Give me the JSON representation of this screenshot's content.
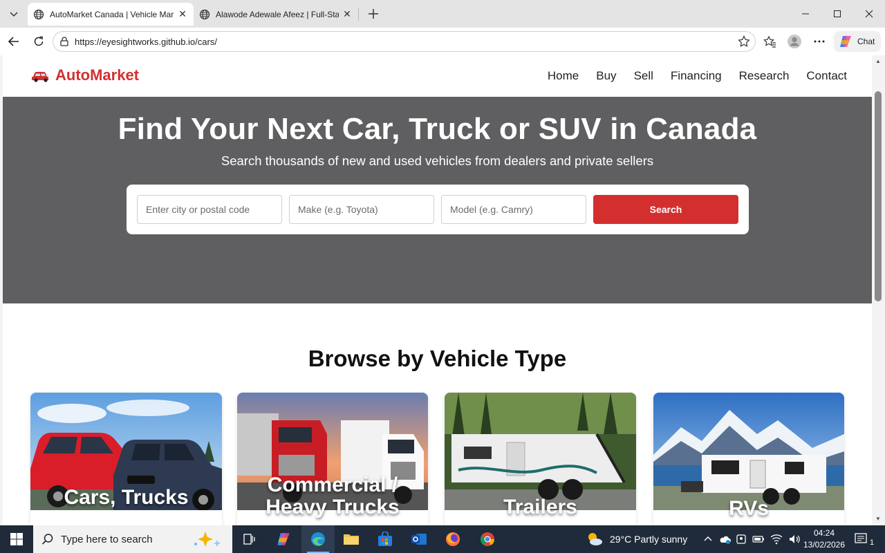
{
  "browser": {
    "tabs": [
      {
        "title": "AutoMarket Canada | Vehicle Marketplace",
        "active": true
      },
      {
        "title": "Alawode Adewale Afeez | Full-Stack Developer",
        "active": false
      }
    ],
    "url": "https://eyesightworks.github.io/cars/",
    "chat_label": "Chat"
  },
  "site": {
    "logo_text": "AutoMarket",
    "brand_color": "#d32f2f",
    "nav": [
      "Home",
      "Buy",
      "Sell",
      "Financing",
      "Research",
      "Contact"
    ]
  },
  "hero": {
    "title": "Find Your Next Car, Truck or SUV in Canada",
    "subtitle": "Search thousands of new and used vehicles from dealers and private sellers",
    "location_placeholder": "Enter city or postal code",
    "make_placeholder": "Make (e.g. Toyota)",
    "model_placeholder": "Model (e.g. Camry)",
    "search_label": "Search"
  },
  "browse": {
    "title": "Browse by Vehicle Type",
    "cards": [
      {
        "label": "Cars, Trucks"
      },
      {
        "label": "Commercial / Heavy Trucks"
      },
      {
        "label": "Trailers"
      },
      {
        "label": "RVs"
      }
    ]
  },
  "taskbar": {
    "search_placeholder": "Type here to search",
    "weather": "29°C  Partly sunny",
    "time": "04:24",
    "date": "13/02/2026",
    "notification_count": "1"
  }
}
